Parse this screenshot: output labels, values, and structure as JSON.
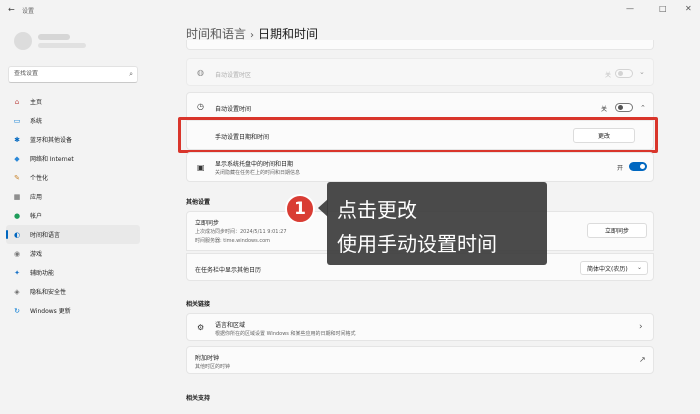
{
  "titlebar": {
    "app_title": "设置",
    "back_icon": "back-arrow-icon",
    "minimize": "—",
    "maximize": "□",
    "close": "✕"
  },
  "search": {
    "placeholder": "查找设置",
    "icon": "search-icon"
  },
  "sidebar": {
    "items": [
      {
        "label": "主页",
        "icon": "home-icon",
        "glyph": "⌂",
        "color": "#c0504d"
      },
      {
        "label": "系统",
        "icon": "monitor-icon",
        "glyph": "▭",
        "color": "#0078d4"
      },
      {
        "label": "蓝牙和其他设备",
        "icon": "bluetooth-icon",
        "glyph": "✱",
        "color": "#0067c0"
      },
      {
        "label": "网络和 Internet",
        "icon": "wifi-icon",
        "glyph": "◆",
        "color": "#2b88d8"
      },
      {
        "label": "个性化",
        "icon": "brush-icon",
        "glyph": "✎",
        "color": "#c8832a"
      },
      {
        "label": "应用",
        "icon": "apps-icon",
        "glyph": "▦",
        "color": "#555555"
      },
      {
        "label": "帐户",
        "icon": "account-icon",
        "glyph": "●",
        "color": "#1e9c5a"
      },
      {
        "label": "时间和语言",
        "icon": "globe-clock-icon",
        "glyph": "◐",
        "color": "#0067c0"
      },
      {
        "label": "游戏",
        "icon": "gamepad-icon",
        "glyph": "◉",
        "color": "#777777"
      },
      {
        "label": "辅助功能",
        "icon": "accessibility-icon",
        "glyph": "✦",
        "color": "#1a73c8"
      },
      {
        "label": "隐私和安全性",
        "icon": "shield-icon",
        "glyph": "◈",
        "color": "#6b6b6b"
      },
      {
        "label": "Windows 更新",
        "icon": "windows-update-icon",
        "glyph": "↻",
        "color": "#0078d4"
      }
    ],
    "active_index": 7
  },
  "breadcrumb": {
    "parent": "时间和语言",
    "separator": "›",
    "current": "日期和时间"
  },
  "timezone_row": {
    "title": "自动设置时区",
    "state": "关",
    "icon": "globe-icon",
    "chevron": "⌄"
  },
  "auto_time_row": {
    "title": "自动设置时间",
    "state": "关",
    "icon": "clock-icon",
    "chevron": "⌃"
  },
  "manual_row": {
    "title": "手动设置日期和时间",
    "button": "更改"
  },
  "tray_row": {
    "title": "显示系统托盘中的时间和日期",
    "subtitle": "关闭隐藏在任务栏上的时间和日期信息",
    "state": "开",
    "icon": "calendar-icon"
  },
  "other_settings": {
    "heading": "其他设置",
    "sync_title": "立即同步",
    "sync_line1": "上次成功同步时间：2024/5/11 9:01:27",
    "sync_line2": "时间服务器: time.windows.com",
    "sync_button": "立即同步",
    "calendar_title": "在任务栏中显示其他日历",
    "calendar_select": "简体中文(农历)"
  },
  "related_links": {
    "heading": "相关链接",
    "region_title": "语言和区域",
    "region_subtitle": "根据你所在的区域设置 Windows 和某些应用的日期和时间格式",
    "clocks_title": "附加时钟",
    "clocks_subtitle": "其他时区的时钟",
    "chevron": "›",
    "external_icon": "↗"
  },
  "related_support": {
    "heading": "相关支持"
  },
  "callout": {
    "step_number": "1",
    "line1": "点击更改",
    "line2": "使用手动设置时间"
  },
  "colors": {
    "accent": "#0067c0",
    "highlight": "#d9352b"
  }
}
